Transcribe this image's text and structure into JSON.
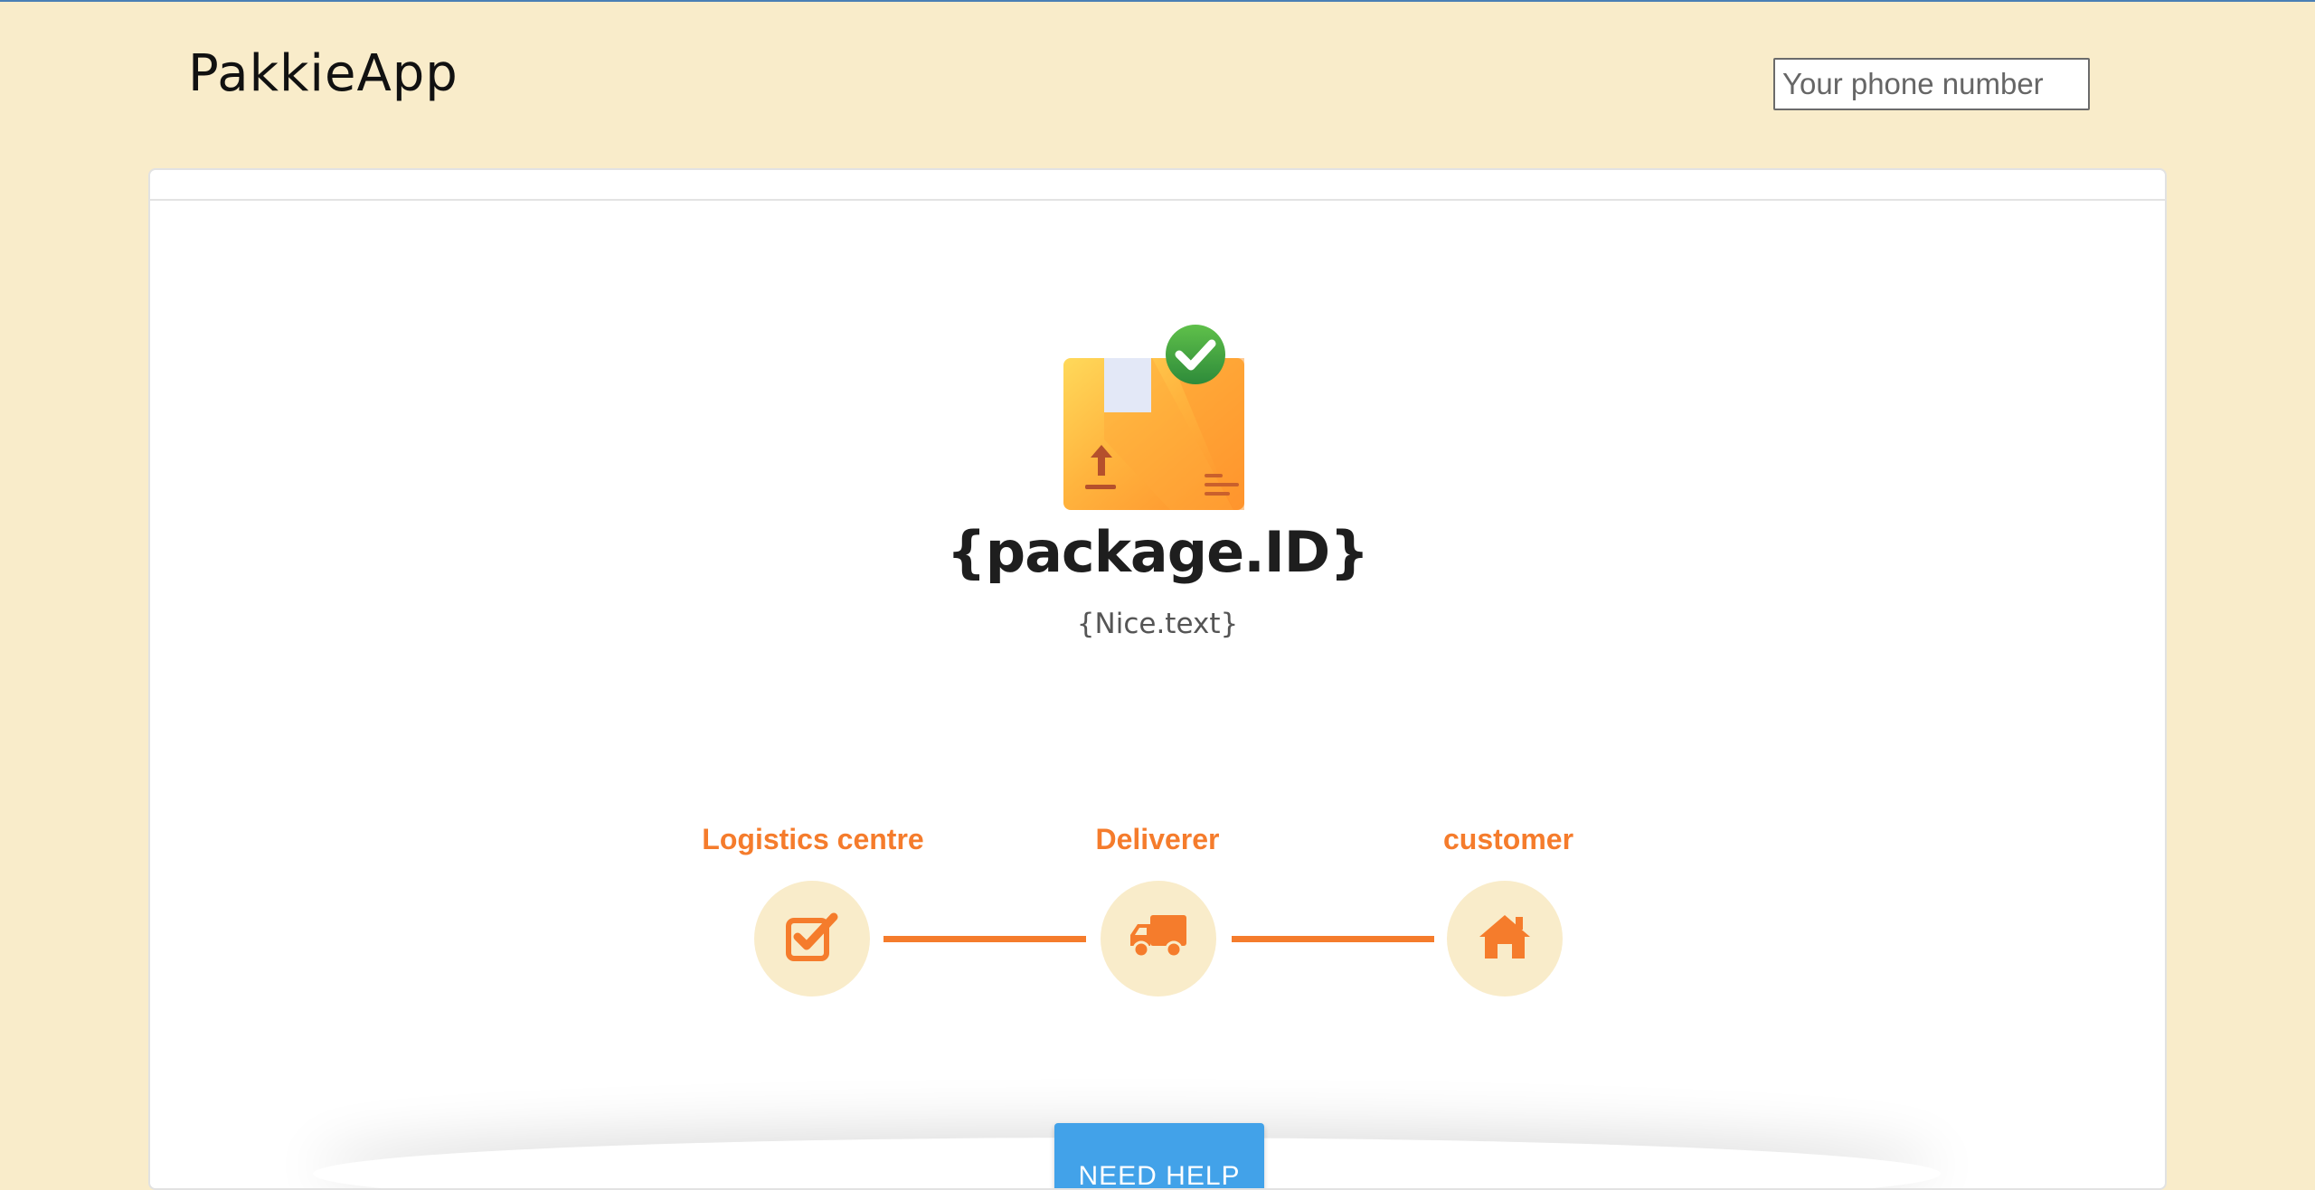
{
  "app": {
    "title": "PakkieApp"
  },
  "header": {
    "phone_placeholder": "Your phone number"
  },
  "package": {
    "id": "{package.ID}",
    "nice_text": "{Nice.text}",
    "icon": "package-delivered-icon"
  },
  "tracking": {
    "steps": [
      {
        "label": "Logistics centre",
        "icon": "checkbox-icon"
      },
      {
        "label": "Deliverer",
        "icon": "truck-icon"
      },
      {
        "label": "customer",
        "icon": "home-icon"
      }
    ]
  },
  "help": {
    "button_label": "NEED HELP"
  },
  "colors": {
    "background": "#f9ecca",
    "accent": "#f57c2c",
    "button": "#42a2e9"
  }
}
